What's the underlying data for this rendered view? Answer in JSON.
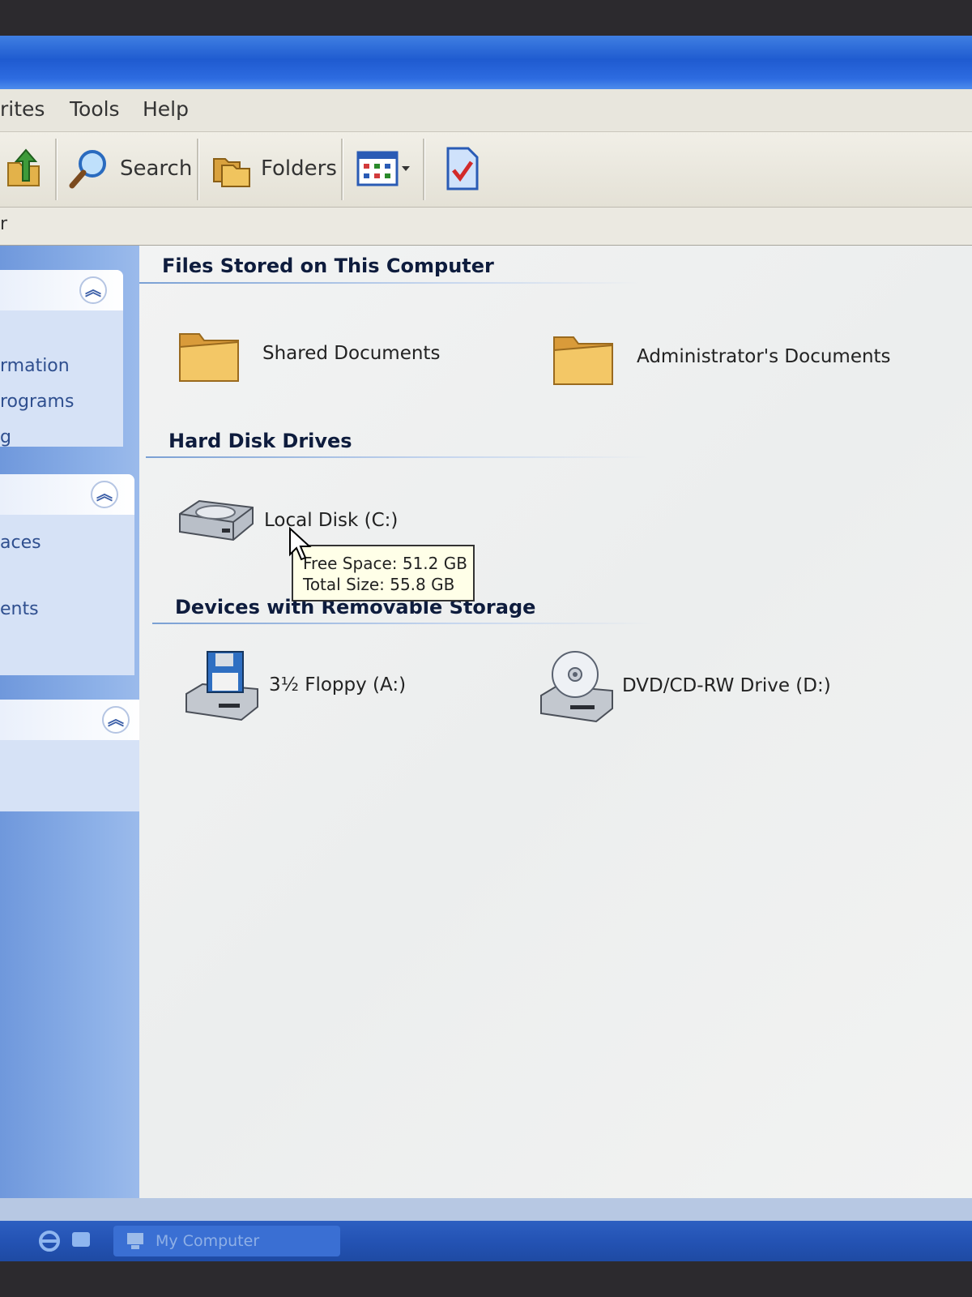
{
  "menubar": {
    "items": [
      "rites",
      "Tools",
      "Help"
    ]
  },
  "toolbar": {
    "search_label": "Search",
    "folders_label": "Folders"
  },
  "address": {
    "partial": "r"
  },
  "sidebar": {
    "panel1_links": [
      "rmation",
      "rograms",
      "g"
    ],
    "panel2_links": [
      "aces",
      "ents"
    ]
  },
  "sections": {
    "files": {
      "title": "Files Stored on This Computer",
      "items": [
        "Shared Documents",
        "Administrator's Documents"
      ]
    },
    "drives": {
      "title": "Hard Disk Drives",
      "items": [
        "Local Disk (C:)"
      ]
    },
    "removable": {
      "title": "Devices with Removable Storage",
      "items": [
        "3½ Floppy (A:)",
        "DVD/CD-RW Drive (D:)"
      ]
    }
  },
  "tooltip": {
    "line1": "Free Space: 51.2 GB",
    "line2": "Total Size: 55.8 GB"
  },
  "taskbar": {
    "window_label": "My Computer"
  },
  "icons": {
    "up": "up-folder-icon",
    "search": "search-magnifier-icon",
    "folders": "folders-icon",
    "views": "views-icon",
    "tasks": "document-check-icon",
    "folder": "folder-icon",
    "hdd": "hard-disk-icon",
    "floppy": "floppy-drive-icon",
    "cd": "cd-drive-icon"
  }
}
